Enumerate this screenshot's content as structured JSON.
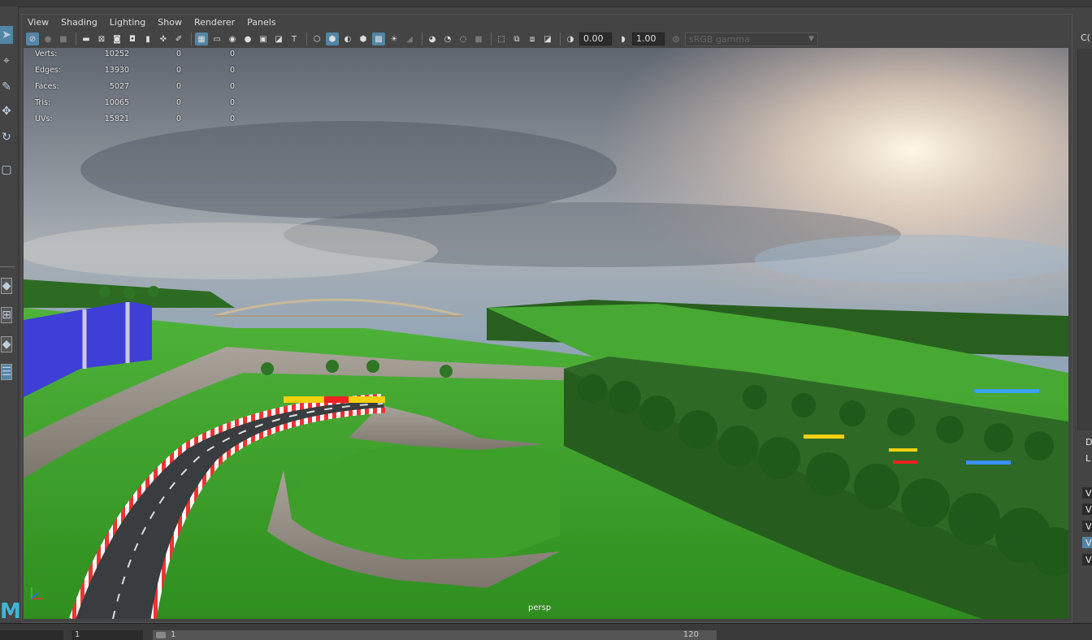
{
  "menu": [
    "View",
    "Shading",
    "Lighting",
    "Show",
    "Renderer",
    "Panels"
  ],
  "toolbar": {
    "exposure": "0.00",
    "gamma": "1.00",
    "color_space": "sRGB gamma"
  },
  "hud": [
    {
      "label": "Verts:",
      "v1": "10252",
      "v2": "0",
      "v3": "0"
    },
    {
      "label": "Edges:",
      "v1": "13930",
      "v2": "0",
      "v3": "0"
    },
    {
      "label": "Faces:",
      "v1": "5027",
      "v2": "0",
      "v3": "0"
    },
    {
      "label": "Tris:",
      "v1": "10065",
      "v2": "0",
      "v3": "0"
    },
    {
      "label": "UVs:",
      "v1": "15821",
      "v2": "0",
      "v3": "0"
    }
  ],
  "camera_label": "persp",
  "right_panel": {
    "tab": "C(",
    "letters": [
      "D",
      "L",
      "V",
      "V",
      "V",
      "V",
      "V"
    ]
  },
  "bottom": {
    "field_left": "1",
    "time_start": "1",
    "time_end": "120"
  },
  "colors": {
    "accent": "#5285a6",
    "ui_bg": "#444444",
    "grass": "#3d9e2a",
    "sky": "#8a9aa8"
  }
}
